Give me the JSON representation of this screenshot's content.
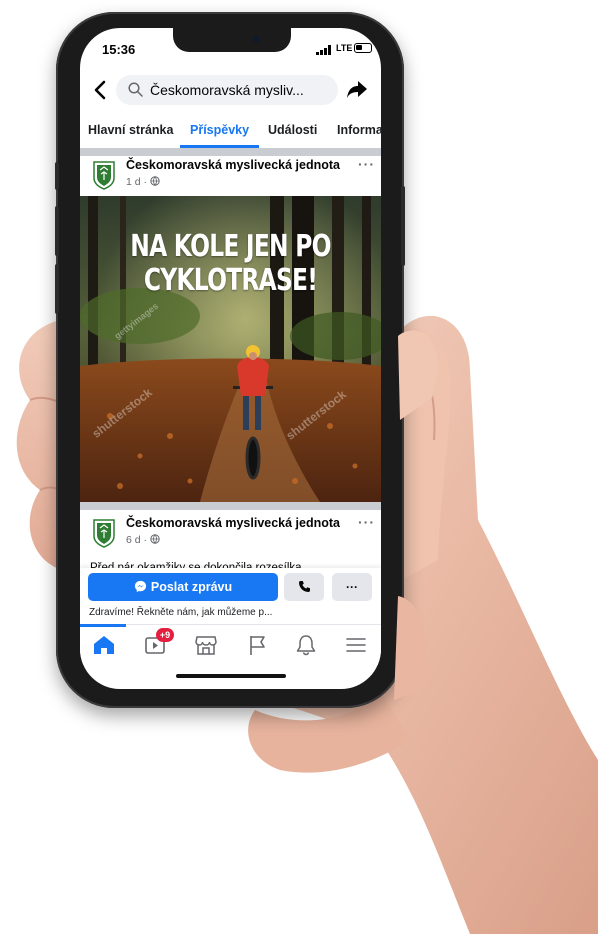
{
  "status_bar": {
    "time": "15:36",
    "network": "LTE"
  },
  "search": {
    "query": "Českomoravská mysliv..."
  },
  "tabs": [
    {
      "label": "Hlavní stránka"
    },
    {
      "label": "Příspěvky",
      "active": true
    },
    {
      "label": "Události"
    },
    {
      "label": "Informa"
    }
  ],
  "posts": [
    {
      "author": "Českomoravská myslivecká jednota",
      "meta": "1 d · ",
      "image_headline_line1": "NA KOLE JEN PO",
      "image_headline_line2": "CYKLOTRASE!",
      "watermarks": [
        "shutterstock",
        "gettyimages",
        "shutterstock"
      ]
    },
    {
      "author": "Českomoravská myslivecká jednota",
      "meta": "6 d · ",
      "text": "Před pár okamžiky se dokončila rozesílka"
    }
  ],
  "cta": {
    "message_button": "Poslat zprávu",
    "more_label": "···",
    "greeting": "Zdravíme! Řekněte nám, jak můžeme p..."
  },
  "nav": {
    "watch_badge": "+9"
  },
  "colors": {
    "accent": "#1877f2",
    "badge": "#e41e3f",
    "text": "#050505",
    "muted": "#65676b"
  },
  "icons": [
    "back-arrow-icon",
    "search-icon",
    "share-icon",
    "globe-icon",
    "more-dots-icon",
    "messenger-icon",
    "phone-icon",
    "home-icon",
    "watch-icon",
    "marketplace-icon",
    "flag-icon",
    "bell-icon",
    "menu-icon"
  ]
}
